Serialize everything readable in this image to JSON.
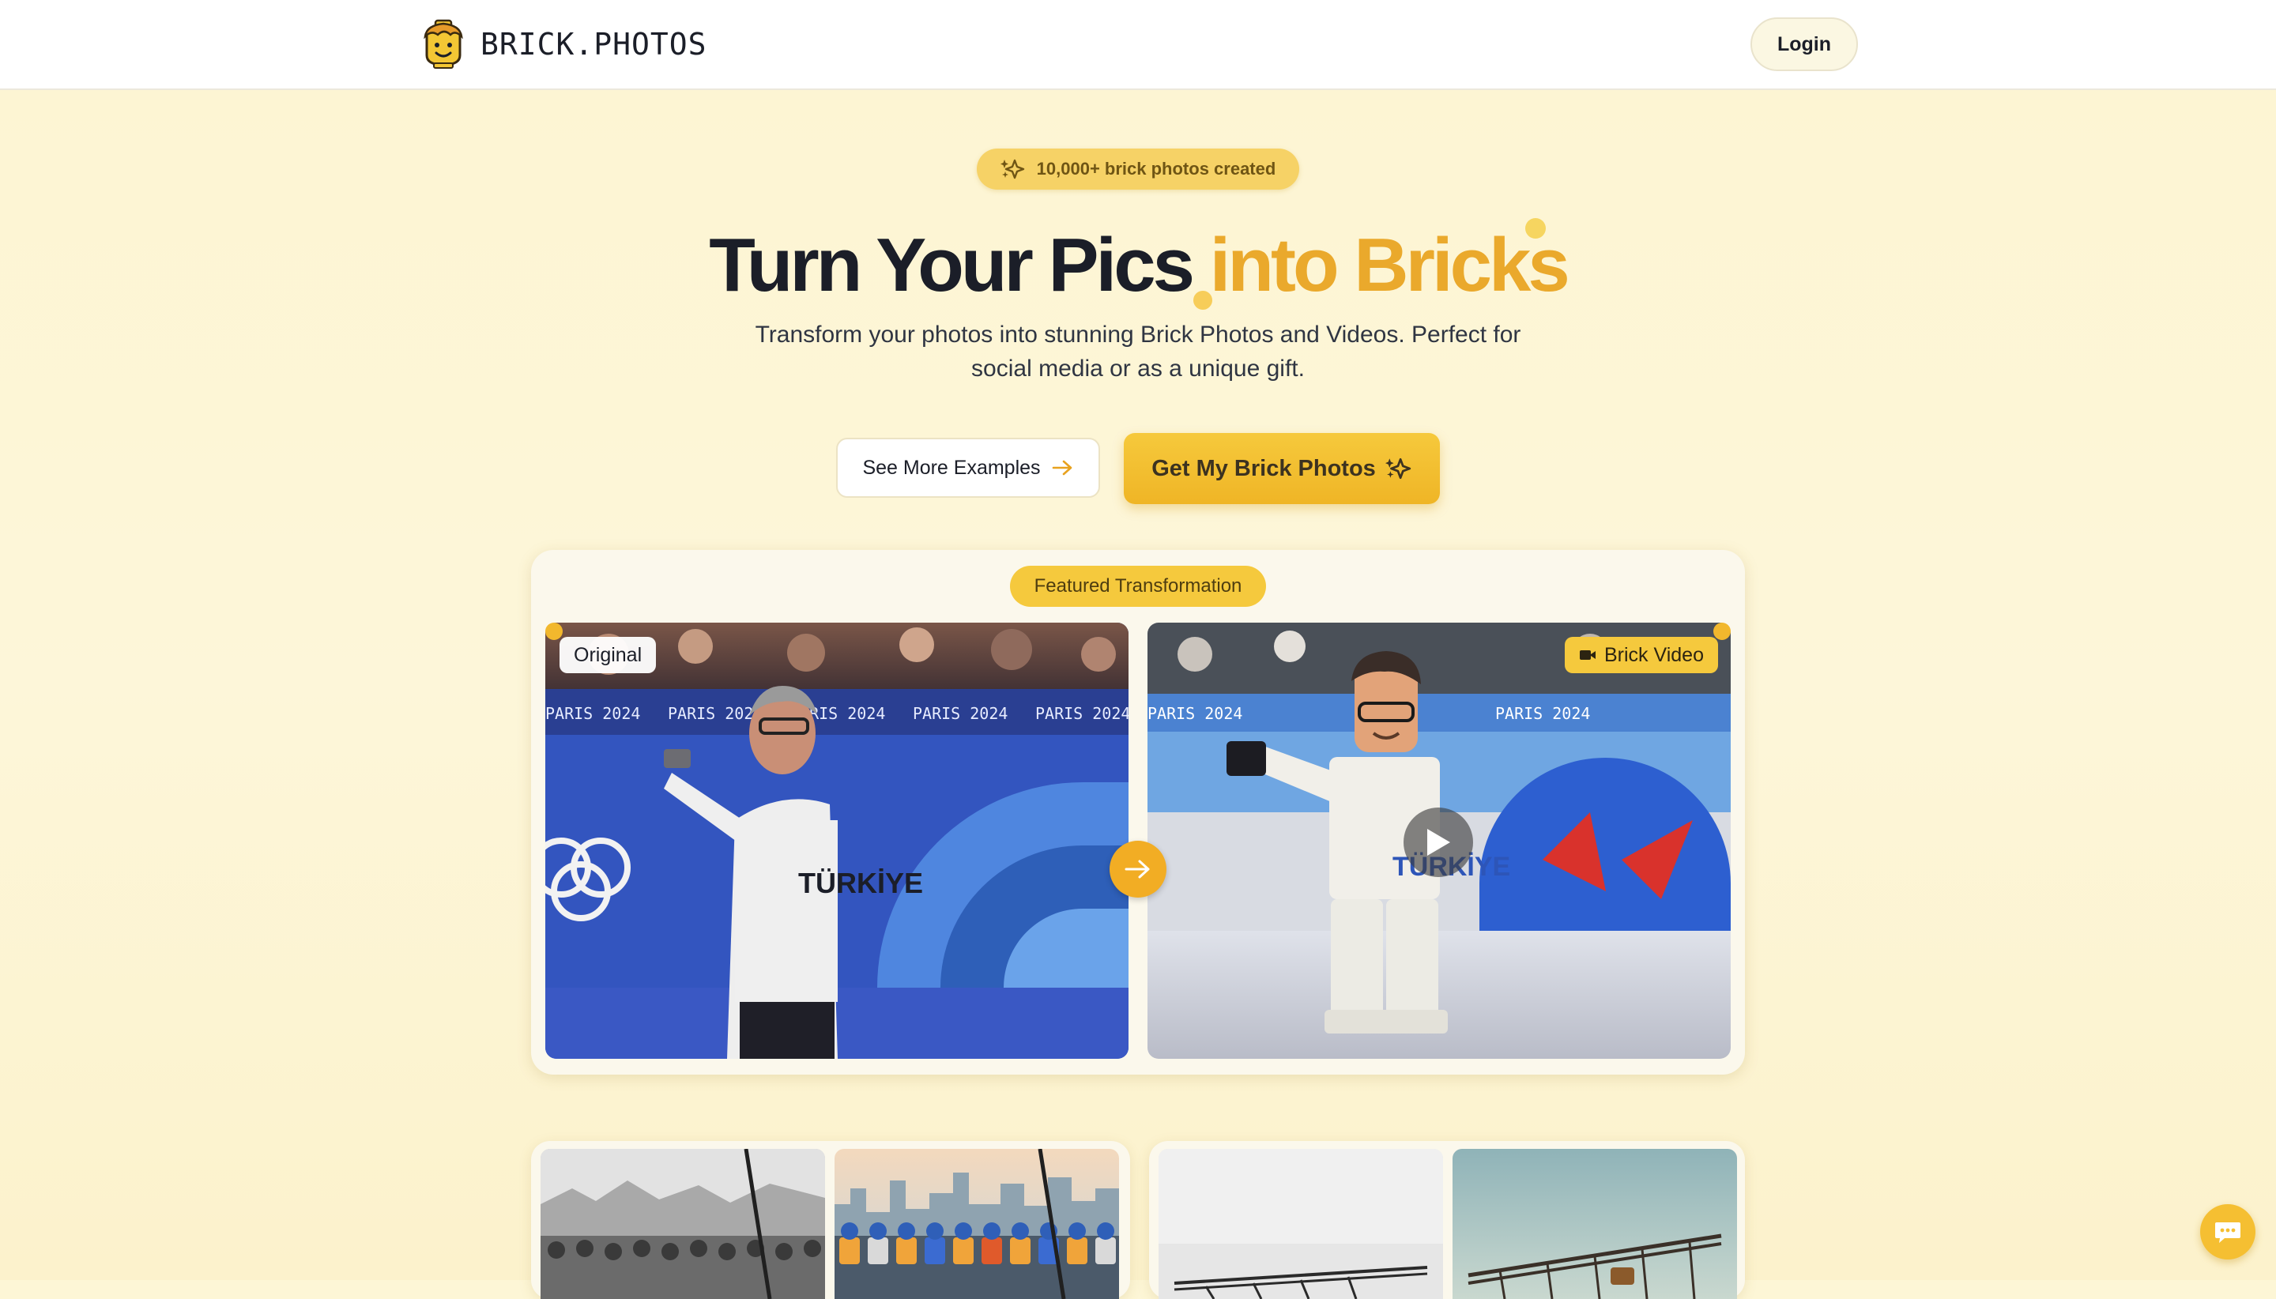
{
  "header": {
    "brand": "BRICK.PHOTOS",
    "login_label": "Login"
  },
  "hero": {
    "badge_text": "10,000+ brick photos created",
    "headline_main": "Turn Your Pics ",
    "headline_accent": "into Bricks",
    "subtitle": "Transform your photos into stunning Brick Photos and Videos. Perfect for social media or as a unique gift.",
    "secondary_button": "See More Examples",
    "primary_button": "Get My Brick Photos"
  },
  "featured": {
    "pill": "Featured Transformation",
    "original_label": "Original",
    "video_label": "Brick Video",
    "backdrop_text": "PARIS 2024"
  },
  "colors": {
    "accent": "#eaa92c",
    "brand_yellow": "#f5c93d",
    "background": "#fdf6d6",
    "text": "#1b1e28"
  },
  "icons": {
    "logo": "brick-head-icon",
    "badge": "sparkle-icon",
    "secondary_button": "arrow-right-icon",
    "primary_button": "sparkle-icon",
    "video_label": "video-camera-icon",
    "swap": "arrow-right-icon",
    "play": "play-icon",
    "chat": "chat-bubble-icon"
  }
}
